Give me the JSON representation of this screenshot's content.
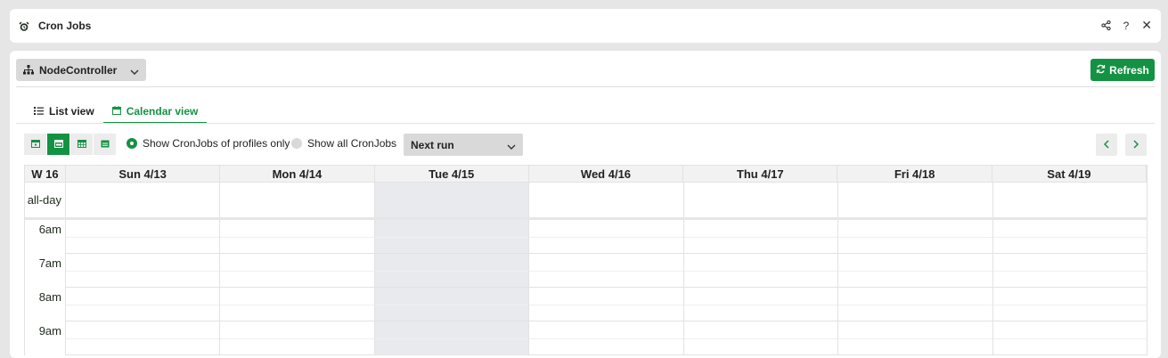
{
  "header": {
    "title": "Cron Jobs",
    "icons": [
      "alarm-clock-icon",
      "share-icon",
      "help-icon",
      "close-icon"
    ],
    "help_label": "?",
    "close_label": "✕"
  },
  "toolbar": {
    "controller": "NodeController",
    "refresh_label": "Refresh",
    "accent": "#149243"
  },
  "tabs": [
    {
      "label": "List view"
    },
    {
      "label": "Calendar view"
    }
  ],
  "filters": {
    "radio_profiles": "Show CronJobs of profiles only",
    "radio_all": "Show all CronJobs",
    "sort_value": "Next run"
  },
  "calendar": {
    "week_label": "W 16",
    "days": [
      "Sun 4/13",
      "Mon 4/14",
      "Tue 4/15",
      "Wed 4/16",
      "Thu 4/17",
      "Fri 4/18",
      "Sat 4/19"
    ],
    "today": "Tue 4/15",
    "allday_label": "all-day",
    "hours": [
      "6am",
      "7am",
      "8am",
      "9am"
    ]
  }
}
